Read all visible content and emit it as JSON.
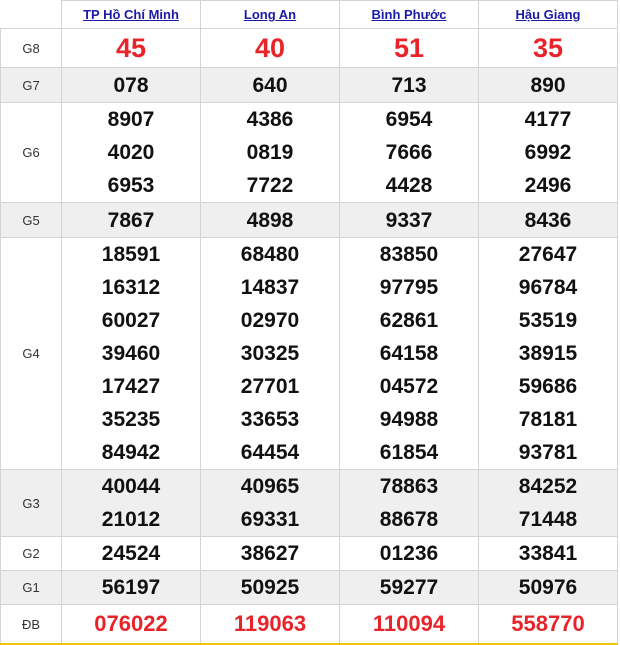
{
  "provinces": [
    "TP Hồ Chí Minh",
    "Long An",
    "Bình Phước",
    "Hậu Giang"
  ],
  "prizes": [
    {
      "label": "G8",
      "values": [
        [
          "45"
        ],
        [
          "40"
        ],
        [
          "51"
        ],
        [
          "35"
        ]
      ]
    },
    {
      "label": "G7",
      "values": [
        [
          "078"
        ],
        [
          "640"
        ],
        [
          "713"
        ],
        [
          "890"
        ]
      ]
    },
    {
      "label": "G6",
      "values": [
        [
          "8907",
          "4020",
          "6953"
        ],
        [
          "4386",
          "0819",
          "7722"
        ],
        [
          "6954",
          "7666",
          "4428"
        ],
        [
          "4177",
          "6992",
          "2496"
        ]
      ]
    },
    {
      "label": "G5",
      "values": [
        [
          "7867"
        ],
        [
          "4898"
        ],
        [
          "9337"
        ],
        [
          "8436"
        ]
      ]
    },
    {
      "label": "G4",
      "values": [
        [
          "18591",
          "16312",
          "60027",
          "39460",
          "17427",
          "35235",
          "84942"
        ],
        [
          "68480",
          "14837",
          "02970",
          "30325",
          "27701",
          "33653",
          "64454"
        ],
        [
          "83850",
          "97795",
          "62861",
          "64158",
          "04572",
          "94988",
          "61854"
        ],
        [
          "27647",
          "96784",
          "53519",
          "38915",
          "59686",
          "78181",
          "93781"
        ]
      ]
    },
    {
      "label": "G3",
      "values": [
        [
          "40044",
          "21012"
        ],
        [
          "40965",
          "69331"
        ],
        [
          "78863",
          "88678"
        ],
        [
          "84252",
          "71448"
        ]
      ]
    },
    {
      "label": "G2",
      "values": [
        [
          "24524"
        ],
        [
          "38627"
        ],
        [
          "01236"
        ],
        [
          "33841"
        ]
      ]
    },
    {
      "label": "G1",
      "values": [
        [
          "56197"
        ],
        [
          "50925"
        ],
        [
          "59277"
        ],
        [
          "50976"
        ]
      ]
    },
    {
      "label": "ĐB",
      "values": [
        [
          "076022"
        ],
        [
          "119063"
        ],
        [
          "110094"
        ],
        [
          "558770"
        ]
      ]
    }
  ],
  "colors": {
    "accent_red": "#e8242a",
    "link_blue": "#1a1aa8",
    "row_shade": "#efefef"
  }
}
